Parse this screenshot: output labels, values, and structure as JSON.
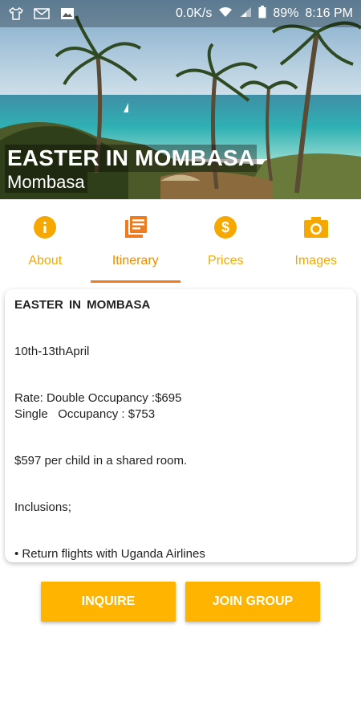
{
  "status_bar": {
    "net_speed": "0.0K/s",
    "battery": "89%",
    "time": "8:16 PM",
    "icons": [
      "tshirt-icon",
      "gmail-icon",
      "image-icon",
      "wifi-icon",
      "signal-icon",
      "battery-icon"
    ]
  },
  "hero": {
    "title": "EASTER IN MOMBASA",
    "subtitle": "Mombasa"
  },
  "tabs": [
    {
      "label": "About",
      "icon": "info-icon"
    },
    {
      "label": "Itinerary",
      "icon": "itinerary-icon"
    },
    {
      "label": "Prices",
      "icon": "dollar-icon"
    },
    {
      "label": "Images",
      "icon": "camera-icon"
    }
  ],
  "active_tab": "Itinerary",
  "content": {
    "heading": "EASTER  IN  MOMBASA",
    "dates": "10th-13thApril",
    "rate": "Rate: Double Occupancy :$695\nSingle   Occupancy : $753",
    "child": "$597 per child in a shared room.",
    "inclusions": "Inclusions;",
    "item1": "• Return flights with Uganda Airlines"
  },
  "buttons": {
    "inquire": "INQUIRE",
    "join": "JOIN GROUP"
  },
  "colors": {
    "accent": "#f6a800",
    "button": "#ffb400",
    "underline": "#f07b1e"
  }
}
